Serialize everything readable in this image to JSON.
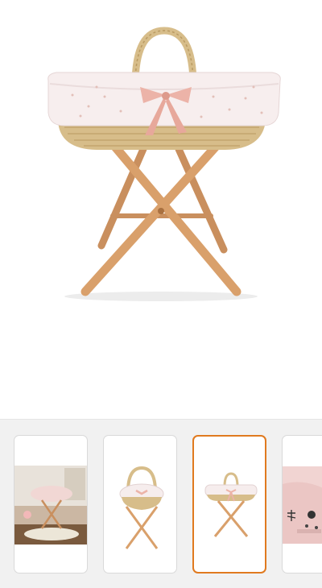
{
  "product": {
    "main_image": "moses-basket-on-wooden-stand",
    "accent_color": "#e07a1f"
  },
  "gallery": {
    "selected_index": 2,
    "thumbnails": [
      {
        "image": "lifestyle-room-photo"
      },
      {
        "image": "basket-angle-view"
      },
      {
        "image": "basket-front-view"
      },
      {
        "image": "pink-blanket-closeup"
      }
    ]
  }
}
